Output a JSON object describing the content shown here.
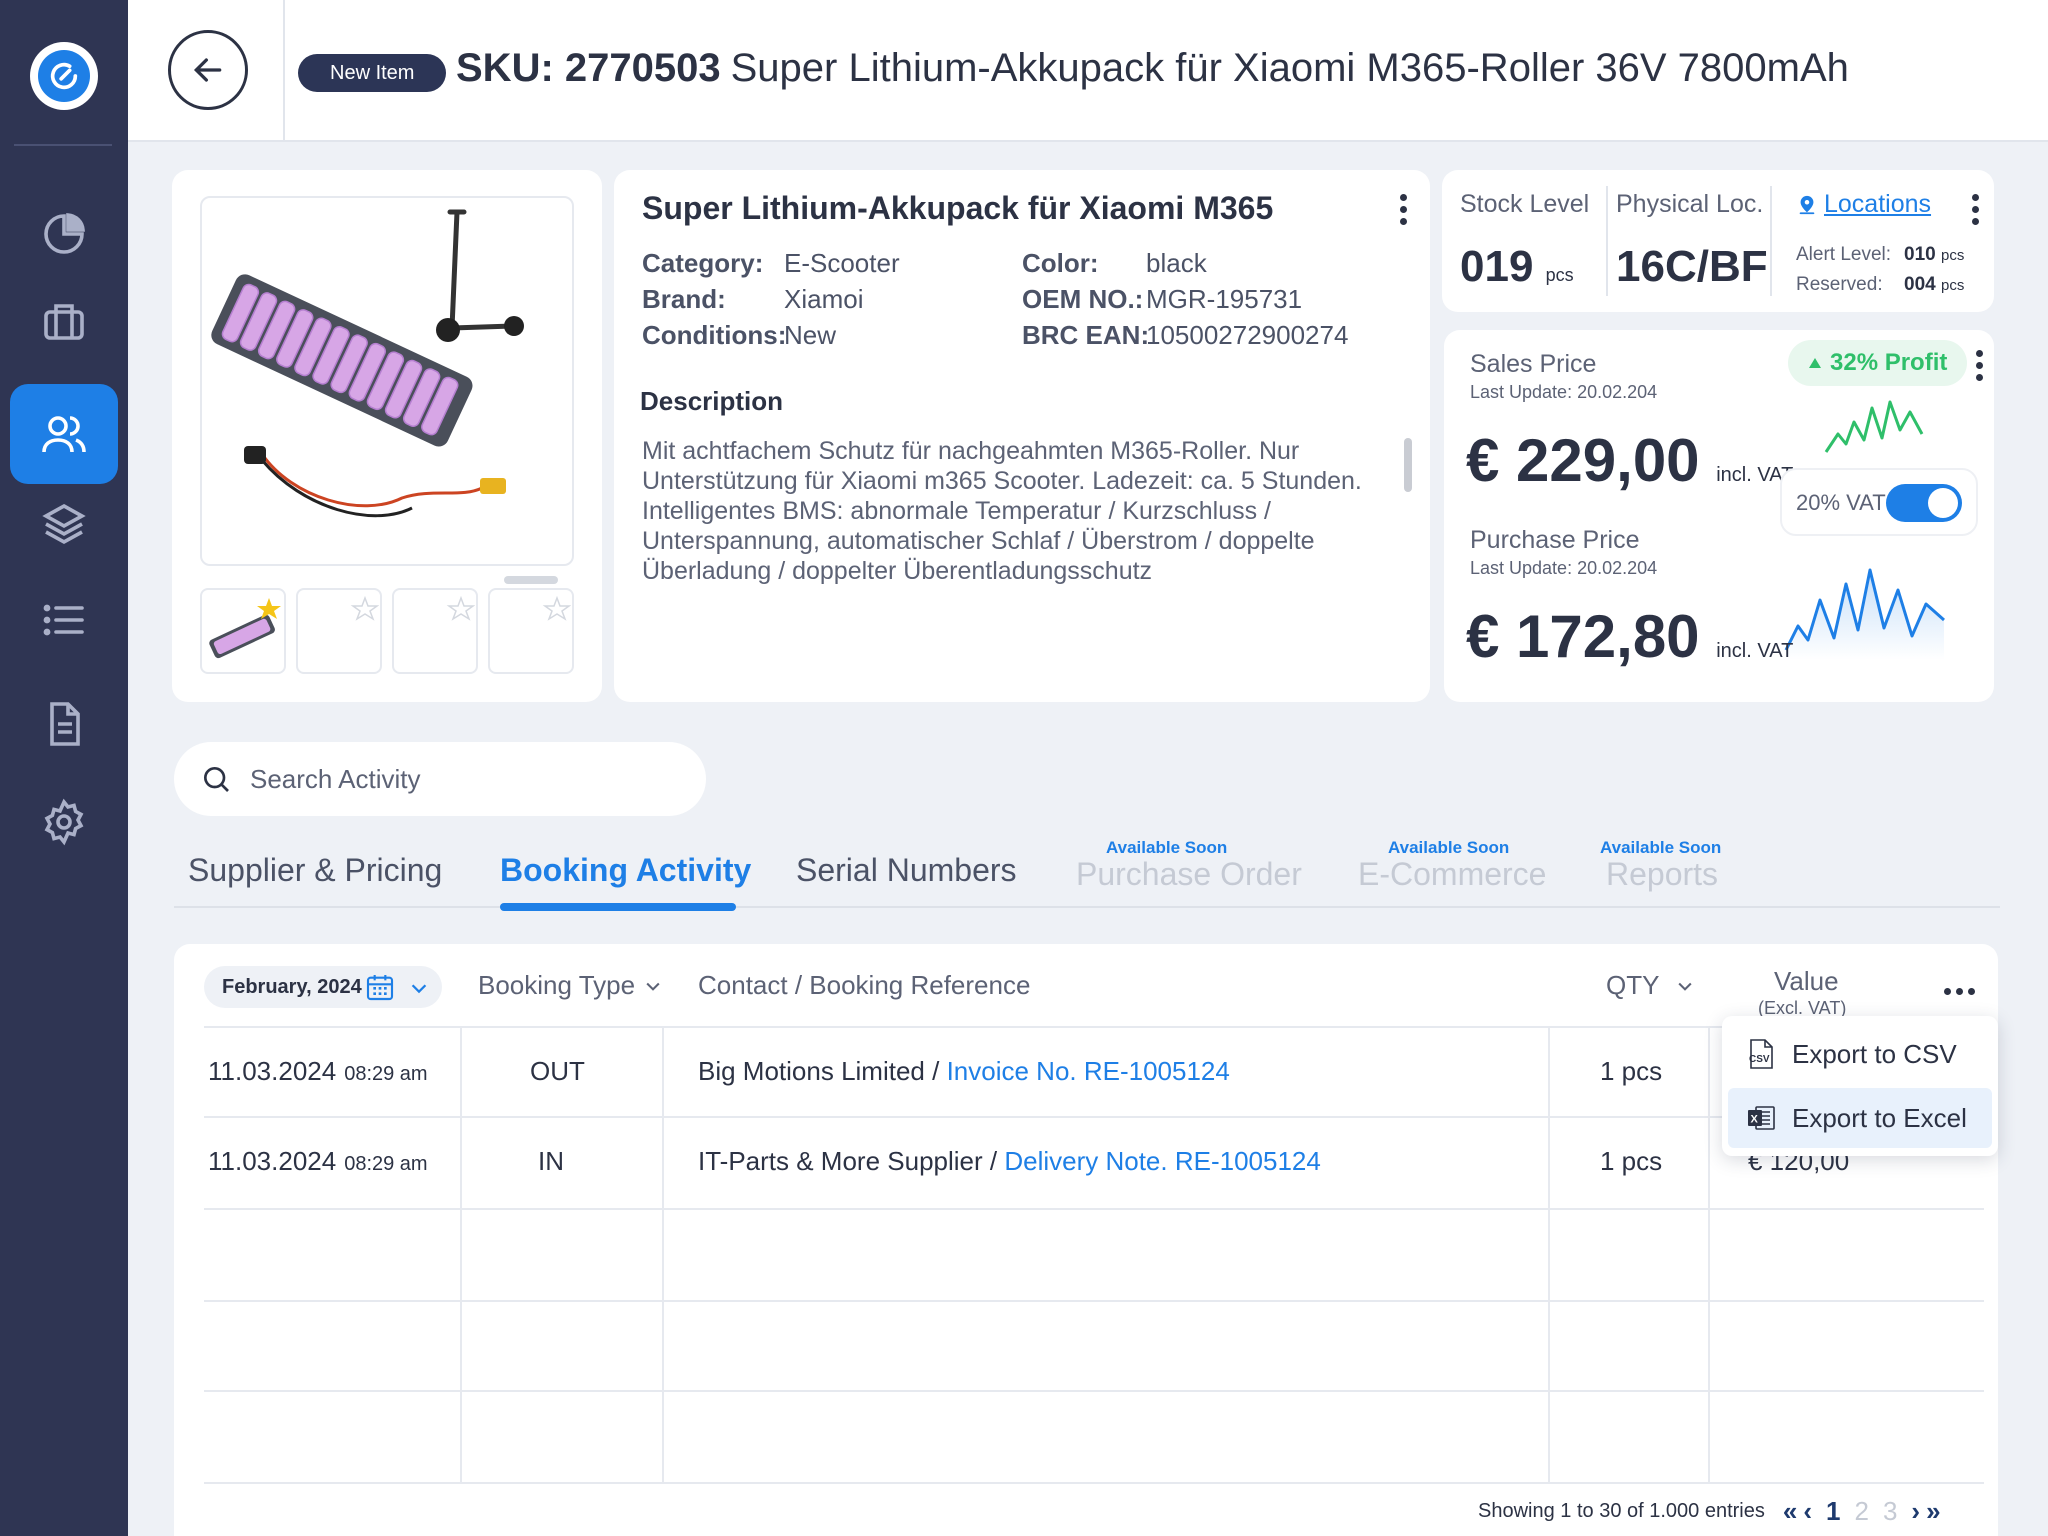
{
  "header": {
    "badge": "New Item",
    "sku": "SKU: 2770503",
    "title": "Super Lithium-Akkupack für Xiaomi M365-Roller 36V 7800mAh"
  },
  "product": {
    "name": "Super Lithium-Akkupack für Xiaomi M365",
    "props_left": [
      {
        "key": "Category:",
        "value": "E-Scooter"
      },
      {
        "key": "Brand:",
        "value": "Xiamoi"
      },
      {
        "key": "Conditions:",
        "value": "New"
      }
    ],
    "props_right": [
      {
        "key": "Color:",
        "value": "black"
      },
      {
        "key": "OEM NO.:",
        "value": "MGR-195731"
      },
      {
        "key": "BRC EAN:",
        "value": "10500272900274"
      }
    ],
    "description_title": "Description",
    "description": "Mit achtfachem Schutz für nachgeahmten M365-Roller. Nur Unterstützung für Xiaomi m365 Scooter. Ladezeit: ca. 5 Stunden. Intelligentes BMS: abnormale Temperatur / Kurzschluss / Unterspannung, automatischer Schlaf / Überstrom / doppelte Überladung / doppelter Überentladungsschutz"
  },
  "stock": {
    "stock_label": "Stock Level",
    "stock_value": "019",
    "stock_unit": "pcs",
    "loc_label": "Physical Loc.",
    "loc_value": "16C/BF",
    "locations_link": "Locations",
    "alert_label": "Alert Level:",
    "alert_value": "010",
    "alert_unit": "pcs",
    "reserved_label": "Reserved:",
    "reserved_value": "004",
    "reserved_unit": "pcs"
  },
  "pricing": {
    "sales_label": "Sales Price",
    "sales_update": "Last Update: 20.02.204",
    "sales_value": "€ 229,00",
    "sales_vat": "incl. VAT",
    "profit": "32% Profit",
    "vat_toggle_label": "20% VAT",
    "vat_on": true,
    "purchase_label": "Purchase Price",
    "purchase_update": "Last Update: 20.02.204",
    "purchase_value": "€ 172,80",
    "purchase_vat": "incl. VAT"
  },
  "search": {
    "placeholder": "Search Activity"
  },
  "tabs": [
    {
      "label": "Supplier & Pricing",
      "state": "normal",
      "badge": ""
    },
    {
      "label": "Booking Activity",
      "state": "active",
      "badge": ""
    },
    {
      "label": "Serial Numbers",
      "state": "normal",
      "badge": ""
    },
    {
      "label": "Purchase Order",
      "state": "disabled",
      "badge": "Available Soon"
    },
    {
      "label": "E-Commerce",
      "state": "disabled",
      "badge": "Available Soon"
    },
    {
      "label": "Reports",
      "state": "disabled",
      "badge": "Available Soon"
    }
  ],
  "table": {
    "date_filter": "February, 2024",
    "col_type": "Booking Type",
    "col_contact": "Contact / Booking Reference",
    "col_qty": "QTY",
    "col_value": "Value",
    "col_value_sub": "(Excl. VAT)",
    "rows": [
      {
        "date": "11.03.2024",
        "time": "08:29 am",
        "type": "OUT",
        "contact": "Big Motions Limited /",
        "ref": "Invoice No. RE-1005124",
        "qty": "1 pcs",
        "value": ""
      },
      {
        "date": "11.03.2024",
        "time": "08:29 am",
        "type": "IN",
        "contact": "IT-Parts & More Supplier /",
        "ref": "Delivery Note. RE-1005124",
        "qty": "1 pcs",
        "value": "€ 120,00"
      }
    ]
  },
  "export_menu": {
    "csv": "Export to CSV",
    "excel": "Export to Excel"
  },
  "pagination": {
    "summary": "Showing 1 to 30 of 1.000 entries",
    "pages": [
      "1",
      "2",
      "3"
    ],
    "current": "1"
  },
  "colors": {
    "sidebar": "#2f3553",
    "accent": "#1e7fe6",
    "profit": "#2fbf6a"
  }
}
